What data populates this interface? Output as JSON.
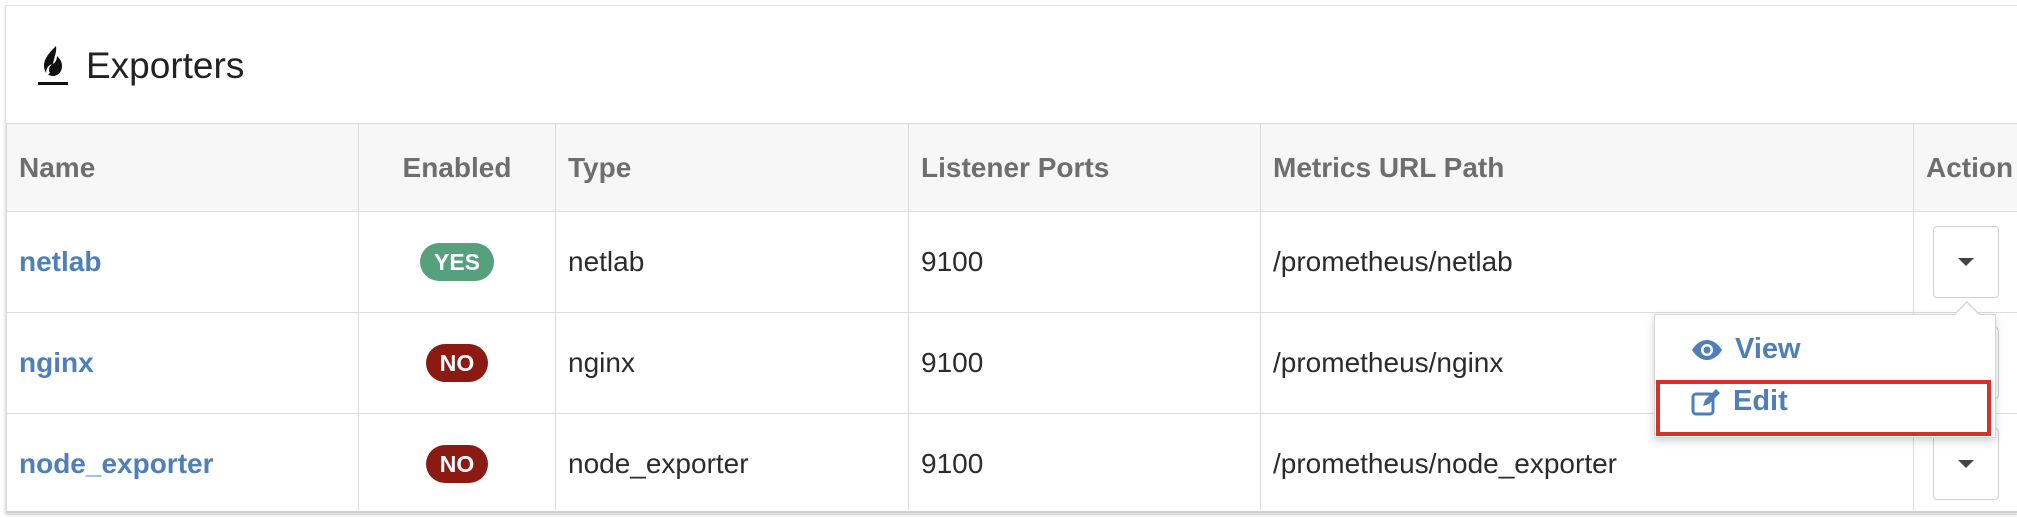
{
  "header": {
    "title": "Exporters",
    "icon": "flame-icon"
  },
  "table": {
    "columns": {
      "name": "Name",
      "enabled": "Enabled",
      "type": "Type",
      "ports": "Listener Ports",
      "path": "Metrics URL Path",
      "action": "Action"
    },
    "rows": [
      {
        "name": "netlab",
        "enabled": "YES",
        "enabled_color": "#57a07e",
        "type": "netlab",
        "ports": "9100",
        "path": "/prometheus/netlab"
      },
      {
        "name": "nginx",
        "enabled": "NO",
        "enabled_color": "#8b1a12",
        "type": "nginx",
        "ports": "9100",
        "path": "/prometheus/nginx"
      },
      {
        "name": "node_exporter",
        "enabled": "NO",
        "enabled_color": "#8b1a12",
        "type": "node_exporter",
        "ports": "9100",
        "path": "/prometheus/node_exporter"
      }
    ]
  },
  "dropdown": {
    "view_label": "View",
    "edit_label": "Edit",
    "view_icon": "eye-icon",
    "edit_icon": "edit-icon"
  },
  "colors": {
    "link": "#4f7fb8",
    "highlight": "#d9302b"
  }
}
